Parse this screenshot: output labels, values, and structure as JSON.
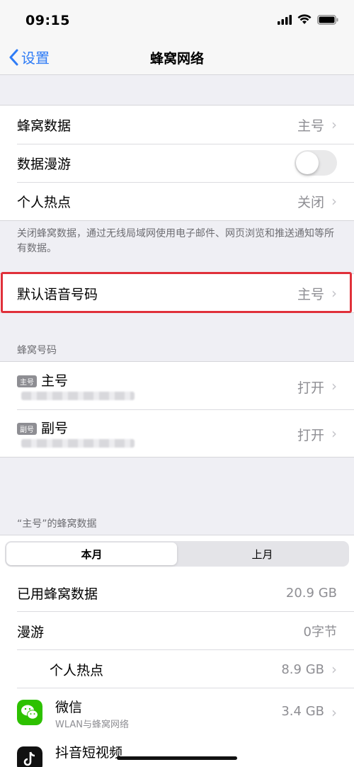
{
  "status": {
    "time": "09:15"
  },
  "nav": {
    "back_label": "设置",
    "title": "蜂窝网络"
  },
  "group1": {
    "cellular_data": {
      "label": "蜂窝数据",
      "value": "主号"
    },
    "data_roaming": {
      "label": "数据漫游",
      "on": false
    },
    "hotspot": {
      "label": "个人热点",
      "value": "关闭"
    }
  },
  "footnote": "关闭蜂窝数据，通过无线局域网使用电子邮件、网页浏览和推送通知等所有数据。",
  "default_voice": {
    "label": "默认语音号码",
    "value": "主号"
  },
  "sim_section": {
    "header": "蜂窝号码",
    "primary": {
      "badge": "主号",
      "label": "主号",
      "value": "打开"
    },
    "secondary": {
      "badge": "副号",
      "label": "副号",
      "value": "打开"
    }
  },
  "usage_section": {
    "header": "“主号”的蜂窝数据",
    "tabs": [
      "本月",
      "上月"
    ],
    "used": {
      "label": "已用蜂窝数据",
      "value": "20.9 GB"
    },
    "roaming": {
      "label": "漫游",
      "value": "0字节"
    },
    "hotspot": {
      "label": "个人热点",
      "value": "8.9 GB"
    },
    "wechat": {
      "name": "微信",
      "sub": "WLAN与蜂窝网络",
      "value": "3.4 GB"
    },
    "douyin": {
      "name": "抖音短视频"
    }
  },
  "colors": {
    "accent": "#2f7cf6",
    "highlight": "#e0303a"
  }
}
